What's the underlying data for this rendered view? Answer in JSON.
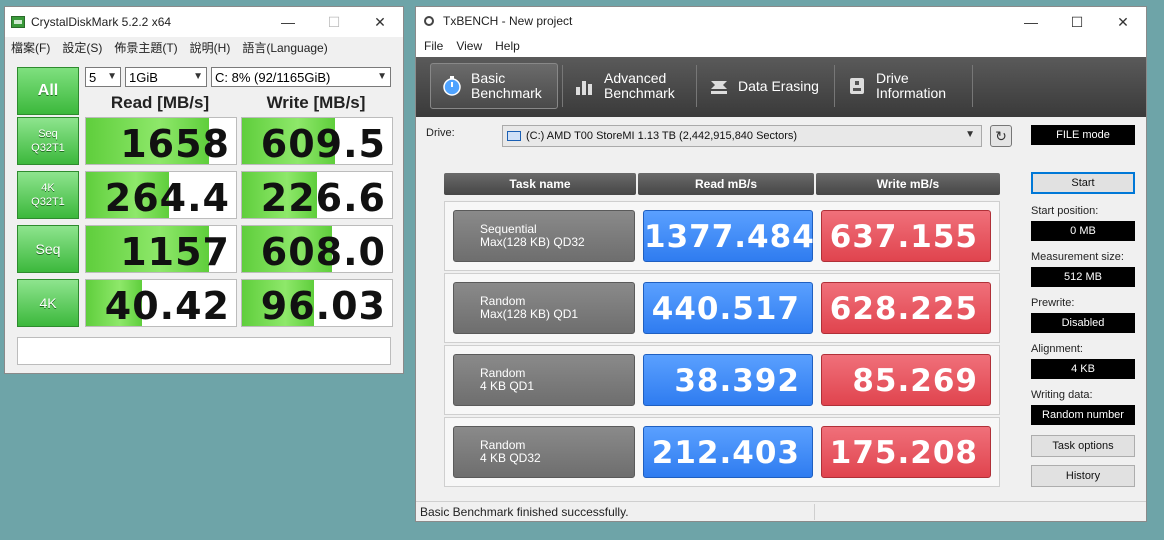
{
  "cdm": {
    "title": "CrystalDiskMark 5.2.2 x64",
    "menu": [
      "檔案(F)",
      "設定(S)",
      "佈景主題(T)",
      "說明(H)",
      "語言(Language)"
    ],
    "all_label": "All",
    "count": "5",
    "size": "1GiB",
    "drive": "C: 8% (92/1165GiB)",
    "read_header": "Read [MB/s]",
    "write_header": "Write [MB/s]",
    "rows": [
      {
        "l1": "Seq",
        "l2": "Q32T1",
        "read": "1658",
        "write": "609.5",
        "read_fill": 0.82,
        "write_fill": 0.62
      },
      {
        "l1": "4K",
        "l2": "Q32T1",
        "read": "264.4",
        "write": "226.6",
        "read_fill": 0.55,
        "write_fill": 0.5
      },
      {
        "l1": "Seq",
        "l2": "",
        "read": "1157",
        "write": "608.0",
        "read_fill": 0.82,
        "write_fill": 0.6
      },
      {
        "l1": "4K",
        "l2": "",
        "read": "40.42",
        "write": "96.03",
        "read_fill": 0.37,
        "write_fill": 0.48
      }
    ]
  },
  "tx": {
    "title": "TxBENCH - New project",
    "menu": [
      "File",
      "View",
      "Help"
    ],
    "tabs": [
      {
        "l1": "Basic",
        "l2": "Benchmark"
      },
      {
        "l1": "Advanced",
        "l2": "Benchmark"
      },
      {
        "l1": "Data Erasing",
        "l2": ""
      },
      {
        "l1": "Drive",
        "l2": "Information"
      }
    ],
    "drive_label": "Drive:",
    "drive_value": "(C:) AMD T00 StoreMI  1.13 TB (2,442,915,840 Sectors)",
    "mode": "FILE mode",
    "headers": {
      "task": "Task name",
      "read": "Read mB/s",
      "write": "Write mB/s"
    },
    "results": [
      {
        "t1": "Sequential",
        "t2": "Max(128 KB) QD32",
        "read": "1377.484",
        "write": "637.155"
      },
      {
        "t1": "Random",
        "t2": "Max(128 KB) QD1",
        "read": "440.517",
        "write": "628.225"
      },
      {
        "t1": "Random",
        "t2": "4 KB QD1",
        "read": "38.392",
        "write": "85.269"
      },
      {
        "t1": "Random",
        "t2": "4 KB QD32",
        "read": "212.403",
        "write": "175.208"
      }
    ],
    "side": {
      "start": "Start",
      "start_pos_label": "Start position:",
      "start_pos": "0 MB",
      "meas_label": "Measurement size:",
      "meas": "512 MB",
      "prewrite_label": "Prewrite:",
      "prewrite": "Disabled",
      "align_label": "Alignment:",
      "align": "4 KB",
      "writing_label": "Writing data:",
      "writing": "Random number",
      "task_options": "Task options",
      "history": "History"
    },
    "status": "Basic Benchmark finished successfully."
  }
}
